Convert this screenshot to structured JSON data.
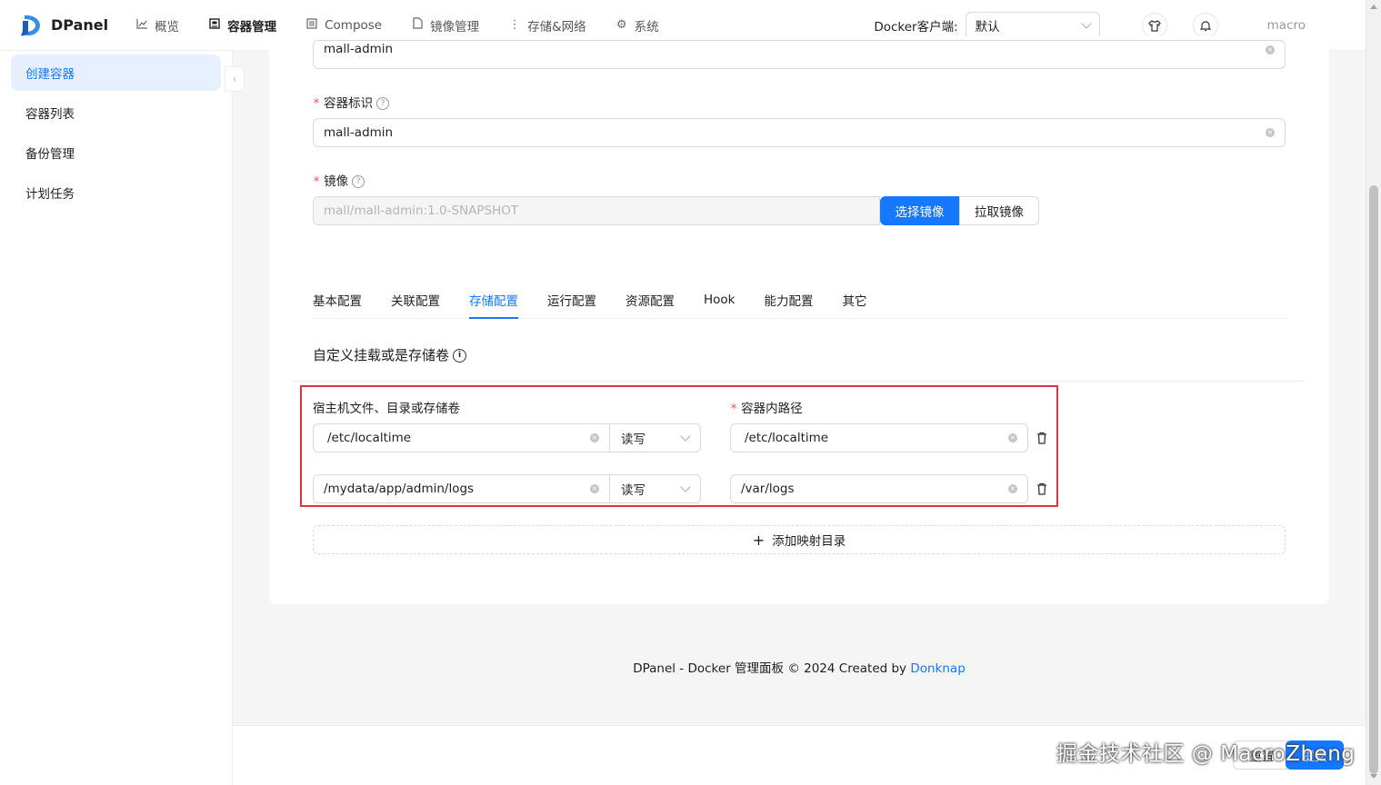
{
  "header": {
    "app_name": "DPanel",
    "nav": [
      {
        "label": "概览",
        "icon": "chart-icon"
      },
      {
        "label": "容器管理",
        "icon": "container-icon",
        "active": true
      },
      {
        "label": "Compose",
        "icon": "compose-icon"
      },
      {
        "label": "镜像管理",
        "icon": "file-icon"
      },
      {
        "label": "存储&网络",
        "icon": "more-vertical-icon"
      },
      {
        "label": "系统",
        "icon": "gear-icon"
      }
    ],
    "client_label": "Docker客户端:",
    "client_value": "默认",
    "user": "macro"
  },
  "sidebar": {
    "items": [
      {
        "label": "创建容器",
        "active": true
      },
      {
        "label": "容器列表"
      },
      {
        "label": "备份管理"
      },
      {
        "label": "计划任务"
      }
    ]
  },
  "form": {
    "top_input_value": "mall-admin",
    "identifier_label": "容器标识",
    "identifier_value": "mall-admin",
    "image_label": "镜像",
    "image_value": "mall/mall-admin:1.0-SNAPSHOT",
    "select_image_button": "选择镜像",
    "pull_image_button": "拉取镜像"
  },
  "tabs": [
    "基本配置",
    "关联配置",
    "存储配置",
    "运行配置",
    "资源配置",
    "Hook",
    "能力配置",
    "其它"
  ],
  "active_tab": "存储配置",
  "storage": {
    "section_title": "自定义挂载或是存储卷",
    "host_label": "宿主机文件、目录或存储卷",
    "container_label": "容器内路径",
    "rows": [
      {
        "host": "/etc/localtime",
        "mode": "读写",
        "container": "/etc/localtime"
      },
      {
        "host": "/mydata/app/admin/logs",
        "mode": "读写",
        "container": "/var/logs"
      }
    ],
    "add_button": "添加映射目录"
  },
  "footer": {
    "text": "DPanel - Docker 管理面板 © 2024 Created by ",
    "link": "Donknap"
  },
  "bottom_bar": {
    "reset_button": "重置",
    "submit_button": "提交"
  },
  "watermark": "掘金技术社区 @ MacroZheng",
  "colors": {
    "primary": "#1677ff",
    "highlight_border": "#d9353b"
  }
}
